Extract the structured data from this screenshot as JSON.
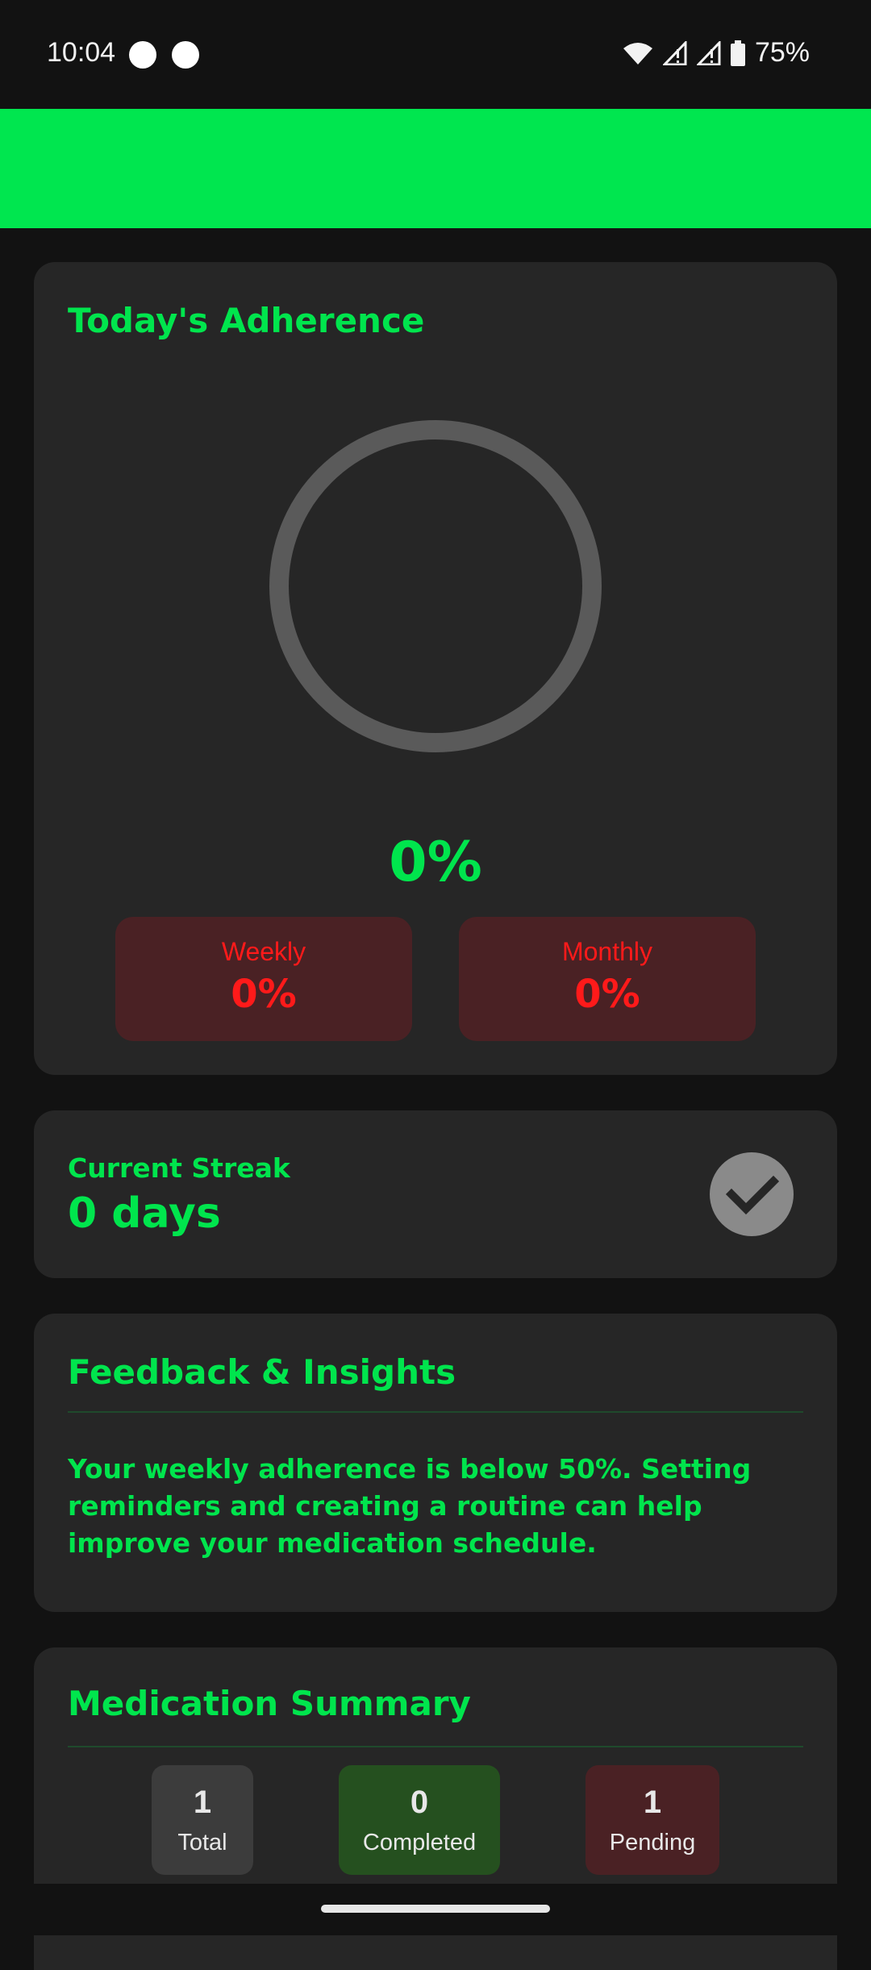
{
  "status_bar": {
    "time": "10:04",
    "battery": "75%",
    "icons": [
      "notification-dot-icon",
      "notification-dot-icon",
      "wifi-icon",
      "signal-icon",
      "signal-icon",
      "battery-icon"
    ]
  },
  "adherence": {
    "title": "Today's Adherence",
    "today_percent": "0%",
    "progress_fraction": 0,
    "weekly": {
      "label": "Weekly",
      "value": "0%"
    },
    "monthly": {
      "label": "Monthly",
      "value": "0%"
    }
  },
  "streak": {
    "label": "Current Streak",
    "value": "0 days",
    "icon": "checkmark-icon"
  },
  "feedback": {
    "title": "Feedback & Insights",
    "message": "Your weekly adherence is below 50%. Setting reminders and creating a routine can help improve your medication schedule."
  },
  "summary": {
    "title": "Medication Summary",
    "stats": [
      {
        "value": "1",
        "label": "Total"
      },
      {
        "value": "0",
        "label": "Completed"
      },
      {
        "value": "1",
        "label": "Pending"
      }
    ]
  },
  "colors": {
    "accent": "#00e54d",
    "header": "#00e64f",
    "background": "#121212",
    "card": "#262626",
    "danger": "#ff1a1a",
    "danger_bg": "#4a2124",
    "success_bg": "#25501f"
  }
}
